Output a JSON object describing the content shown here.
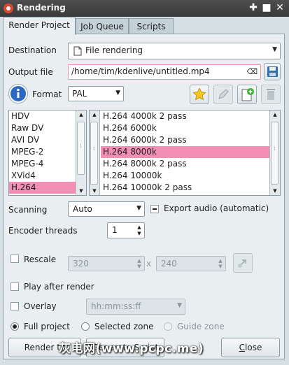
{
  "window": {
    "title": "Rendering"
  },
  "tabs": [
    {
      "label": "Render Project"
    },
    {
      "label": "Job Queue"
    },
    {
      "label": "Scripts"
    }
  ],
  "destination": {
    "label": "Destination",
    "value": "File rendering"
  },
  "output": {
    "label": "Output file",
    "value": "/home/tim/kdenlive/untitled.mp4"
  },
  "format": {
    "label": "Format",
    "value": "PAL"
  },
  "formats_list": [
    "HDV",
    "Raw DV",
    "AVI DV",
    "MPEG-2",
    "MPEG-4",
    "XVid4",
    "H.264"
  ],
  "formats_selected": "H.264",
  "profiles_list": [
    "H.264 4000k 2 pass",
    "H.264 6000k",
    "H.264 6000k 2 pass",
    "H.264 8000k",
    "H.264 8000k 2 pass",
    "H.264 10000k",
    "H.264 10000k 2 pass"
  ],
  "profiles_selected": "H.264 8000k",
  "scanning": {
    "label": "Scanning",
    "value": "Auto"
  },
  "export_audio": {
    "label": "Export audio (automatic)"
  },
  "encoder_threads": {
    "label": "Encoder threads",
    "value": "1"
  },
  "rescale": {
    "label": "Rescale",
    "width": "320",
    "x": "x",
    "height": "240"
  },
  "play_after": {
    "label": "Play after render"
  },
  "overlay": {
    "label": "Overlay",
    "value": "hh:mm:ss:ff"
  },
  "zone": {
    "full": "Full project",
    "selected": "Selected zone",
    "guide": "Guide zone"
  },
  "buttons": {
    "render": "Render to",
    "script": "Generate Script",
    "close": "Close"
  },
  "watermark": "灰电网(www.pcpc.me)",
  "colors": {
    "selection": "#f28fb4",
    "titlebar": "#3f3f3f",
    "window_bg": "#e9eef0"
  }
}
